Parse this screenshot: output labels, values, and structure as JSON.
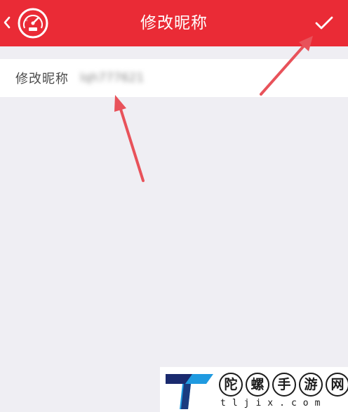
{
  "header": {
    "title": "修改昵称",
    "bg_color": "#ea2b36",
    "back_icon": "chevron-left-icon",
    "logo_icon": "gauge-logo-icon",
    "confirm_icon": "checkmark-icon"
  },
  "form": {
    "label": "修改昵称",
    "value": "lqh777621"
  },
  "annotations": {
    "arrow_color": "#e8525a",
    "arrows": [
      "arrow-to-confirm-button",
      "arrow-to-nickname-field"
    ]
  },
  "watermark": {
    "chars": [
      "陀",
      "螺",
      "手",
      "游",
      "网"
    ],
    "domain": "tljix.com"
  }
}
